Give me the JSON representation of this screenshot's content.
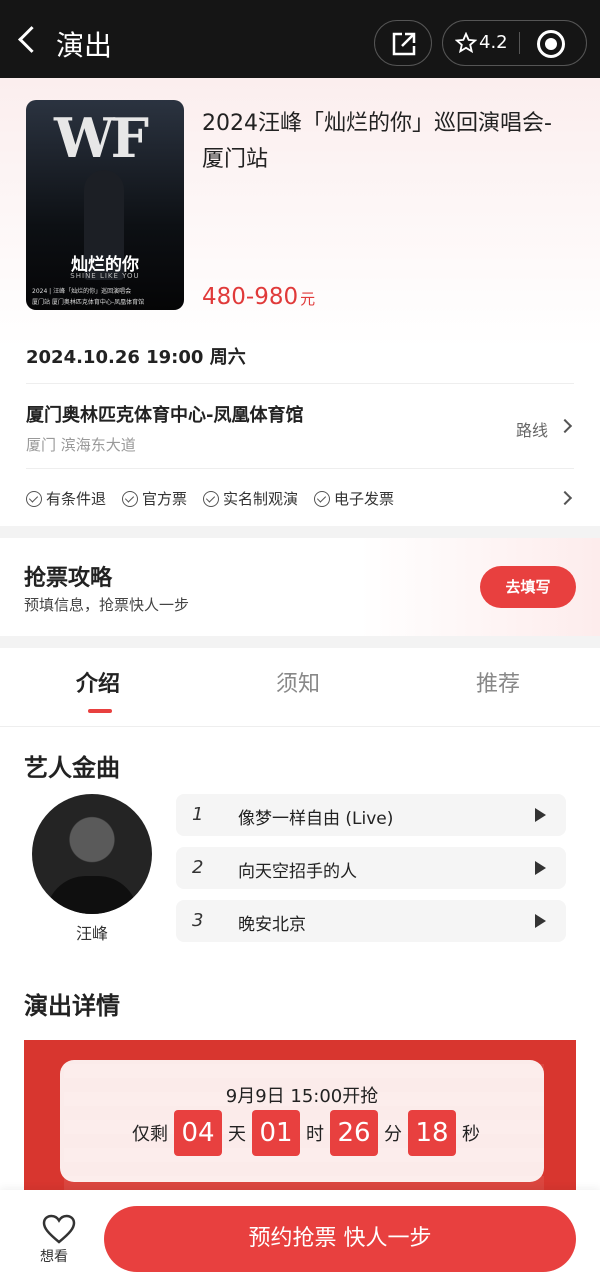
{
  "header": {
    "title": "演出",
    "rating": "4.2"
  },
  "event": {
    "title": "2024汪峰「灿烂的你」巡回演唱会-厦门站",
    "price": "480-980",
    "price_unit": "元",
    "datetime": "2024.10.26 19:00 周六",
    "venue": "厦门奥林匹克体育中心-凤凰体育馆",
    "address": "厦门 滨海东大道",
    "route_label": "路线",
    "tags": [
      "有条件退",
      "官方票",
      "实名制观演",
      "电子发票"
    ],
    "poster": {
      "logo": "WF",
      "title": "灿烂的你",
      "subtitle": "SHINE LIKE YOU",
      "line1": "2024 | 汪峰「灿烂的你」巡回演唱会",
      "line2": "厦门站  厦门奥林匹克体育中心-凤凰体育馆"
    }
  },
  "tips": {
    "title": "抢票攻略",
    "subtitle": "预填信息，抢票快人一步",
    "button": "去填写"
  },
  "tabs": [
    "介绍",
    "须知",
    "推荐"
  ],
  "artist": {
    "section_title": "艺人金曲",
    "name": "汪峰",
    "songs": [
      {
        "num": "1",
        "name": "像梦一样自由 (Live)"
      },
      {
        "num": "2",
        "name": "向天空招手的人"
      },
      {
        "num": "3",
        "name": "晚安北京"
      }
    ]
  },
  "details": {
    "section_title": "演出详情",
    "countdown": {
      "when": "9月9日  15:00开抢",
      "prefix": "仅剩",
      "days": "04",
      "days_unit": "天",
      "hours": "01",
      "hours_unit": "时",
      "minutes": "26",
      "minutes_unit": "分",
      "seconds": "18",
      "seconds_unit": "秒"
    }
  },
  "bottom": {
    "want_label": "想看",
    "cta": "预约抢票 快人一步"
  },
  "colors": {
    "accent": "#e8403f",
    "header_bg": "#151515",
    "price": "#e03a3a"
  },
  "icons": [
    "back-icon",
    "share-icon",
    "star-icon",
    "target-icon",
    "chevron-right-icon",
    "check-circle-icon",
    "play-icon",
    "heart-icon"
  ]
}
